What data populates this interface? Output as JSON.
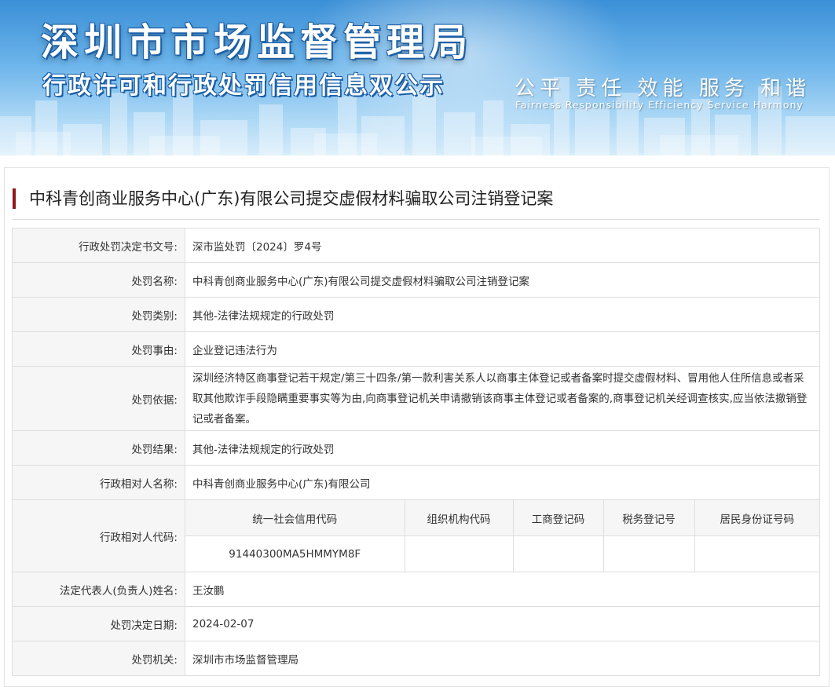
{
  "banner": {
    "title": "深圳市市场监督管理局",
    "subtitle": "行政许可和行政处罚信用信息双公示",
    "slogan": "公平 责任 效能 服务 和谐",
    "slogan_en": "Fairness Responsibility Efficiency Service Harmony"
  },
  "case": {
    "title": "中科青创商业服务中心(广东)有限公司提交虚假材料骗取公司注销登记案"
  },
  "rows": {
    "decision_no": {
      "label": "行政处罚决定书文号:",
      "value": "深市监处罚〔2024〕罗4号"
    },
    "penalty_name": {
      "label": "处罚名称:",
      "value": "中科青创商业服务中心(广东)有限公司提交虚假材料骗取公司注销登记案"
    },
    "penalty_type": {
      "label": "处罚类别:",
      "value": "其他-法律法规规定的行政处罚"
    },
    "penalty_reason": {
      "label": "处罚事由:",
      "value": "企业登记违法行为"
    },
    "penalty_basis": {
      "label": "处罚依据:",
      "value": "深圳经济特区商事登记若干规定/第三十四条/第一款利害关系人以商事主体登记或者备案时提交虚假材料、冒用他人住所信息或者采取其他欺诈手段隐瞒重要事实等为由,向商事登记机关申请撤销该商事主体登记或者备案的,商事登记机关经调查核实,应当依法撤销登记或者备案。"
    },
    "penalty_result": {
      "label": "处罚结果:",
      "value": "其他-法律法规规定的行政处罚"
    },
    "party_name": {
      "label": "行政相对人名称:",
      "value": "中科青创商业服务中心(广东)有限公司"
    },
    "party_code": {
      "label": "行政相对人代码:",
      "headers": [
        "统一社会信用代码",
        "组织机构代码",
        "工商登记码",
        "税务登记号",
        "居民身份证号码"
      ],
      "values": [
        "91440300MA5HMMYM8F",
        "",
        "",
        "",
        ""
      ]
    },
    "legal_rep": {
      "label": "法定代表人(负责人)姓名:",
      "value": "王汝鹏"
    },
    "decision_date": {
      "label": "处罚决定日期:",
      "value": "2024-02-07"
    },
    "authority": {
      "label": "处罚机关:",
      "value": "深圳市市场监督管理局"
    }
  },
  "colors": {
    "banner_top": "#3a8fd6",
    "banner_bottom": "#d6ecfa",
    "title_accent": "#8b1a1a",
    "label_bg": "#f6f6f6",
    "border": "#dedede"
  }
}
